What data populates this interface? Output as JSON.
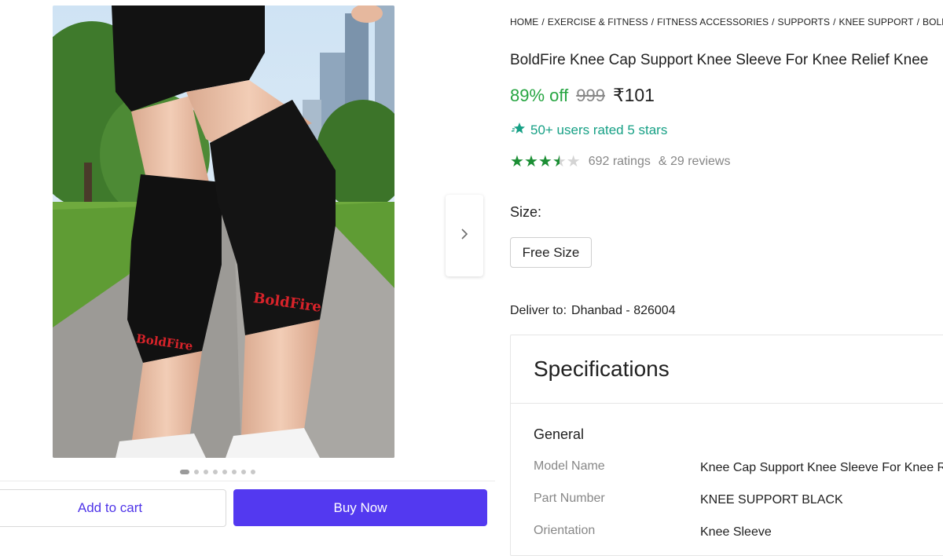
{
  "breadcrumb": [
    "HOME",
    "EXERCISE & FITNESS",
    "FITNESS ACCESSORIES",
    "SUPPORTS",
    "KNEE SUPPORT",
    "BOLDFIRE"
  ],
  "product": {
    "title": "BoldFire Knee Cap Support Knee Sleeve For Knee Relief Knee",
    "discount": "89% off",
    "mrp": "999",
    "price": "₹101",
    "rated_line": "50+ users rated 5 stars",
    "rating_value": 4,
    "ratings_text": "692 ratings",
    "reviews_text": "& 29 reviews",
    "image_brand_text": "BoldFire"
  },
  "size": {
    "label": "Size:",
    "selected": "Free Size"
  },
  "delivery": {
    "label": "Deliver to:",
    "location": "Dhanbad - 826004"
  },
  "specifications": {
    "title": "Specifications",
    "group": "General",
    "rows": [
      {
        "key": "Model Name",
        "value": "Knee Cap Support Knee Sleeve For Knee R"
      },
      {
        "key": "Part Number",
        "value": "KNEE SUPPORT BLACK"
      },
      {
        "key": "Orientation",
        "value": "Knee Sleeve"
      }
    ]
  },
  "gallery": {
    "total_images": 8,
    "active_index": 0
  },
  "actions": {
    "add_to_cart": "Add to cart",
    "buy_now": "Buy Now"
  },
  "colors": {
    "accent": "#5339f0",
    "discount": "#26a541",
    "rated": "#16a085",
    "star": "#1b8e34"
  },
  "icons": {
    "next": "chevron-right-icon",
    "rated": "sparkle-star-icon",
    "rating": "star-icon"
  }
}
